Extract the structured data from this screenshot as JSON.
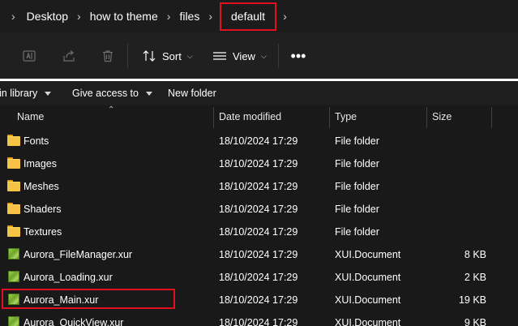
{
  "breadcrumb": {
    "items": [
      "Desktop",
      "how to theme",
      "files",
      "default"
    ],
    "highlight_color": "#e0101e"
  },
  "commandbar": {
    "icons": [
      "rename-icon",
      "share-icon",
      "delete-icon"
    ],
    "sort_label": "Sort",
    "view_label": "View",
    "more_label": "•••"
  },
  "toolbar": {
    "include_label": "in library",
    "share_label": "Give access to",
    "new_folder_label": "New folder"
  },
  "columns": {
    "name": "Name",
    "date": "Date modified",
    "type": "Type",
    "size": "Size"
  },
  "files": [
    {
      "name": "Fonts",
      "date": "18/10/2024 17:29",
      "type": "File folder",
      "size": "",
      "icon": "folder-icon"
    },
    {
      "name": "Images",
      "date": "18/10/2024 17:29",
      "type": "File folder",
      "size": "",
      "icon": "folder-icon"
    },
    {
      "name": "Meshes",
      "date": "18/10/2024 17:29",
      "type": "File folder",
      "size": "",
      "icon": "folder-icon"
    },
    {
      "name": "Shaders",
      "date": "18/10/2024 17:29",
      "type": "File folder",
      "size": "",
      "icon": "folder-icon"
    },
    {
      "name": "Textures",
      "date": "18/10/2024 17:29",
      "type": "File folder",
      "size": "",
      "icon": "folder-icon"
    },
    {
      "name": "Aurora_FileManager.xur",
      "date": "18/10/2024 17:29",
      "type": "XUI.Document",
      "size": "8 KB",
      "icon": "xur-file-icon"
    },
    {
      "name": "Aurora_Loading.xur",
      "date": "18/10/2024 17:29",
      "type": "XUI.Document",
      "size": "2 KB",
      "icon": "xur-file-icon"
    },
    {
      "name": "Aurora_Main.xur",
      "date": "18/10/2024 17:29",
      "type": "XUI.Document",
      "size": "19 KB",
      "icon": "xur-file-icon",
      "highlighted": true
    },
    {
      "name": "Aurora_QuickView.xur",
      "date": "18/10/2024 17:29",
      "type": "XUI.Document",
      "size": "9 KB",
      "icon": "xur-file-icon"
    }
  ]
}
